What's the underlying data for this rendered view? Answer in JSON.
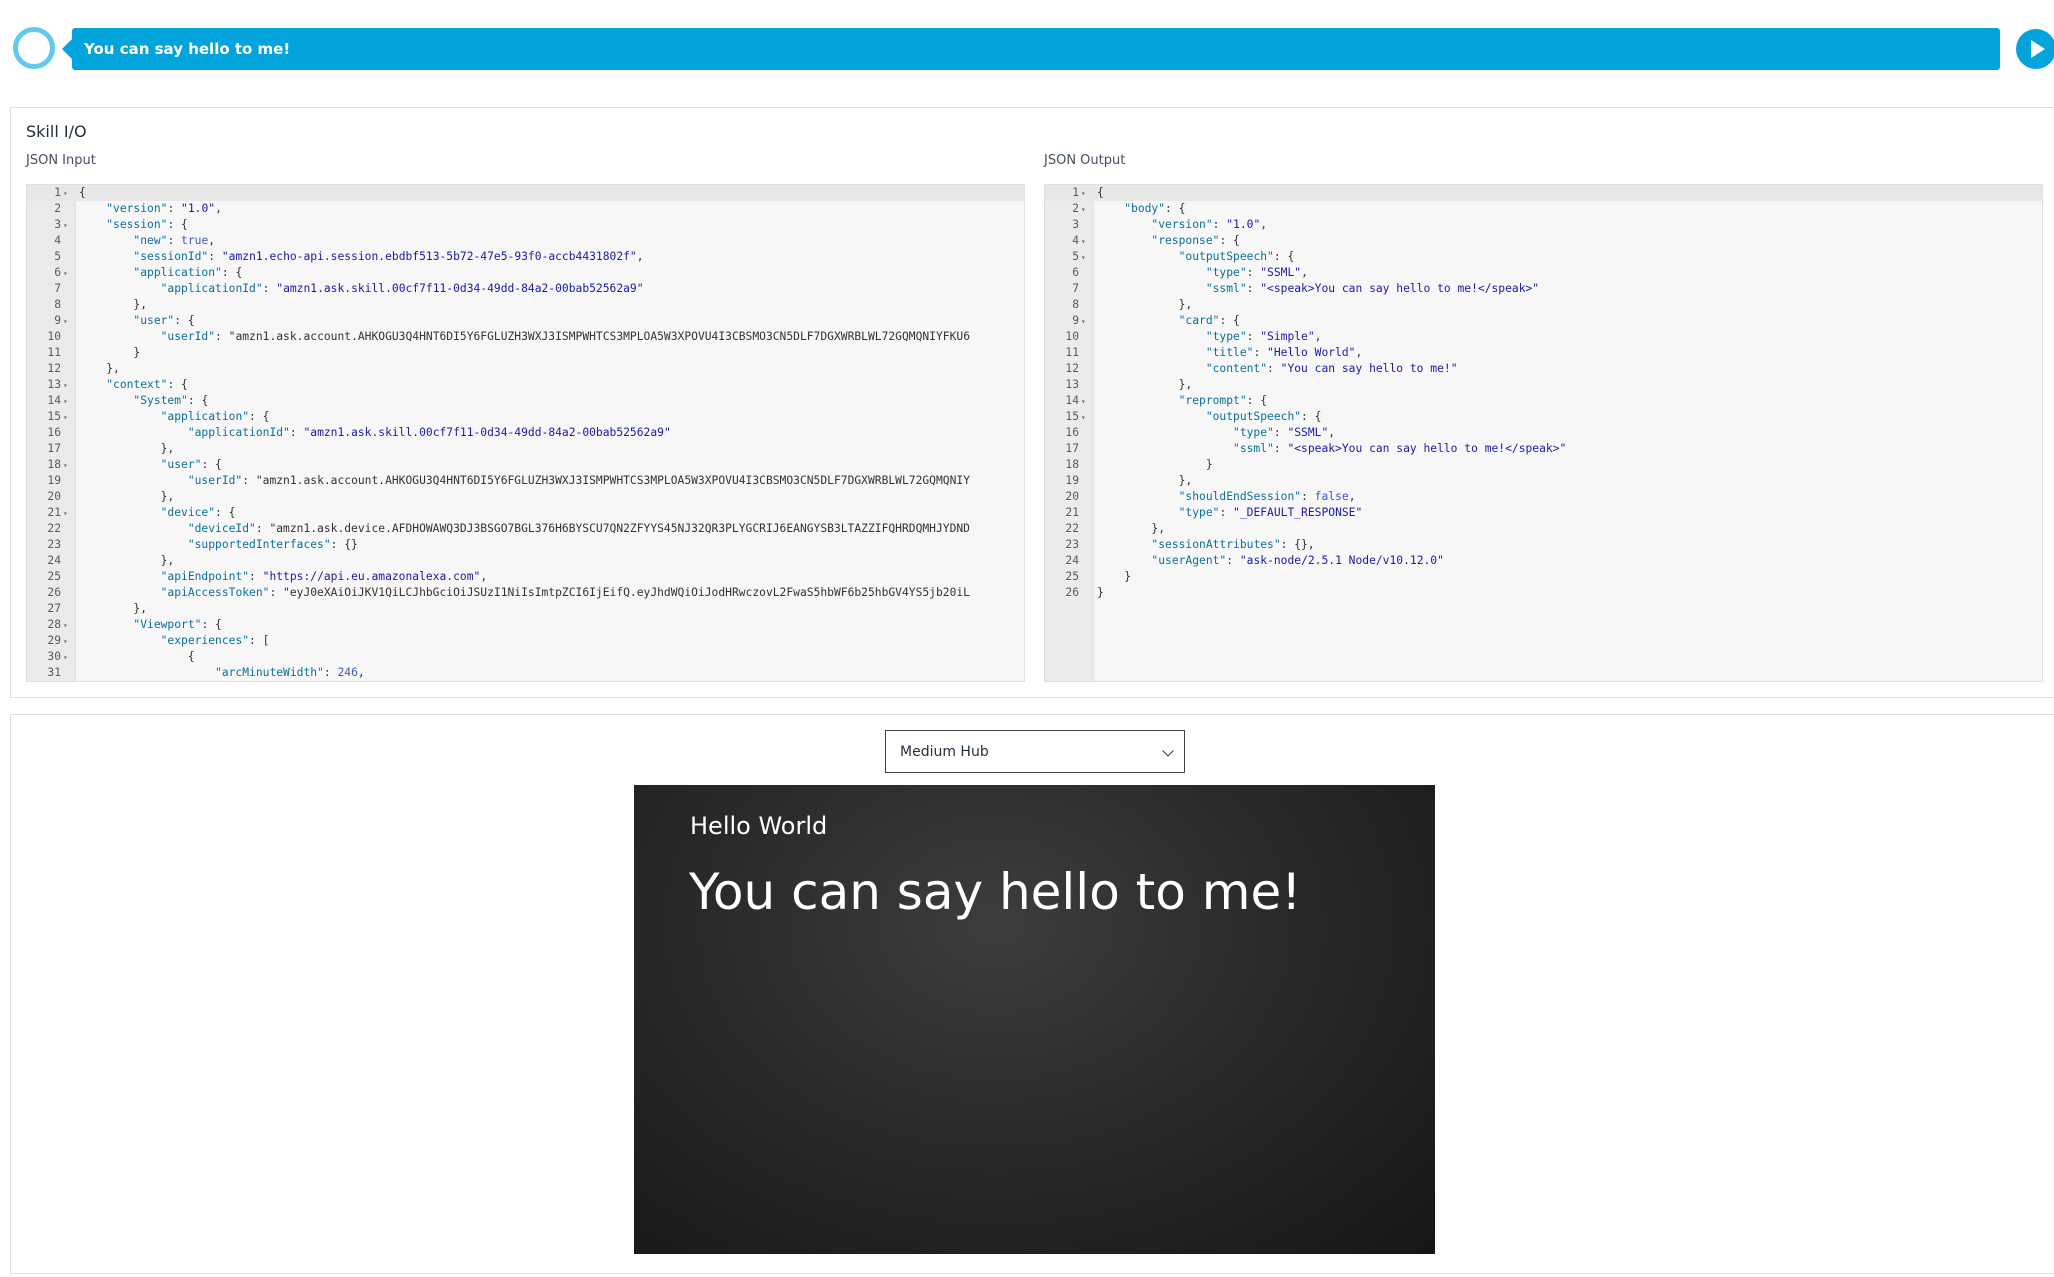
{
  "speech": {
    "text": "You can say hello to me!"
  },
  "skill_io": {
    "title": "Skill I/O",
    "input_label": "JSON Input",
    "output_label": "JSON Output"
  },
  "json_input_lines": [
    {
      "n": "1",
      "f": "▾",
      "t": "{"
    },
    {
      "n": "2",
      "f": "",
      "t": "    \"version\": \"1.0\","
    },
    {
      "n": "3",
      "f": "▾",
      "t": "    \"session\": {"
    },
    {
      "n": "4",
      "f": "",
      "t": "        \"new\": true,"
    },
    {
      "n": "5",
      "f": "",
      "t": "        \"sessionId\": \"amzn1.echo-api.session.ebdbf513-5b72-47e5-93f0-accb4431802f\","
    },
    {
      "n": "6",
      "f": "▾",
      "t": "        \"application\": {"
    },
    {
      "n": "7",
      "f": "",
      "t": "            \"applicationId\": \"amzn1.ask.skill.00cf7f11-0d34-49dd-84a2-00bab52562a9\""
    },
    {
      "n": "8",
      "f": "",
      "t": "        },"
    },
    {
      "n": "9",
      "f": "▾",
      "t": "        \"user\": {"
    },
    {
      "n": "10",
      "f": "",
      "t": "            \"userId\": \"amzn1.ask.account.AHKOGU3Q4HNT6DI5Y6FGLUZH3WXJ3ISMPWHTCS3MPLOA5W3XPOVU4I3CBSMO3CN5DLF7DGXWRBLWL72GQMQNIYFKU6"
    },
    {
      "n": "11",
      "f": "",
      "t": "        }"
    },
    {
      "n": "12",
      "f": "",
      "t": "    },"
    },
    {
      "n": "13",
      "f": "▾",
      "t": "    \"context\": {"
    },
    {
      "n": "14",
      "f": "▾",
      "t": "        \"System\": {"
    },
    {
      "n": "15",
      "f": "▾",
      "t": "            \"application\": {"
    },
    {
      "n": "16",
      "f": "",
      "t": "                \"applicationId\": \"amzn1.ask.skill.00cf7f11-0d34-49dd-84a2-00bab52562a9\""
    },
    {
      "n": "17",
      "f": "",
      "t": "            },"
    },
    {
      "n": "18",
      "f": "▾",
      "t": "            \"user\": {"
    },
    {
      "n": "19",
      "f": "",
      "t": "                \"userId\": \"amzn1.ask.account.AHKOGU3Q4HNT6DI5Y6FGLUZH3WXJ3ISMPWHTCS3MPLOA5W3XPOVU4I3CBSMO3CN5DLF7DGXWRBLWL72GQMQNIY"
    },
    {
      "n": "20",
      "f": "",
      "t": "            },"
    },
    {
      "n": "21",
      "f": "▾",
      "t": "            \"device\": {"
    },
    {
      "n": "22",
      "f": "",
      "t": "                \"deviceId\": \"amzn1.ask.device.AFDHOWAWQ3DJ3BSGO7BGL376H6BYSCU7QN2ZFYYS45NJ32QR3PLYGCRIJ6EANGYSB3LTAZZIFQHRDQMHJYDND"
    },
    {
      "n": "23",
      "f": "",
      "t": "                \"supportedInterfaces\": {}"
    },
    {
      "n": "24",
      "f": "",
      "t": "            },"
    },
    {
      "n": "25",
      "f": "",
      "t": "            \"apiEndpoint\": \"https://api.eu.amazonalexa.com\","
    },
    {
      "n": "26",
      "f": "",
      "t": "            \"apiAccessToken\": \"eyJ0eXAiOiJKV1QiLCJhbGciOiJSUzI1NiIsImtpZCI6IjEifQ.eyJhdWQiOiJodHRwczovL2FwaS5hbWF6b25hbGV4YS5jb20iL"
    },
    {
      "n": "27",
      "f": "",
      "t": "        },"
    },
    {
      "n": "28",
      "f": "▾",
      "t": "        \"Viewport\": {"
    },
    {
      "n": "29",
      "f": "▾",
      "t": "            \"experiences\": ["
    },
    {
      "n": "30",
      "f": "▾",
      "t": "                {"
    },
    {
      "n": "31",
      "f": "",
      "t": "                    \"arcMinuteWidth\": 246,"
    }
  ],
  "json_output_lines": [
    {
      "n": "1",
      "f": "▾",
      "t": "{"
    },
    {
      "n": "2",
      "f": "▾",
      "t": "    \"body\": {"
    },
    {
      "n": "3",
      "f": "",
      "t": "        \"version\": \"1.0\","
    },
    {
      "n": "4",
      "f": "▾",
      "t": "        \"response\": {"
    },
    {
      "n": "5",
      "f": "▾",
      "t": "            \"outputSpeech\": {"
    },
    {
      "n": "6",
      "f": "",
      "t": "                \"type\": \"SSML\","
    },
    {
      "n": "7",
      "f": "",
      "t": "                \"ssml\": \"<speak>You can say hello to me!</speak>\""
    },
    {
      "n": "8",
      "f": "",
      "t": "            },"
    },
    {
      "n": "9",
      "f": "▾",
      "t": "            \"card\": {"
    },
    {
      "n": "10",
      "f": "",
      "t": "                \"type\": \"Simple\","
    },
    {
      "n": "11",
      "f": "",
      "t": "                \"title\": \"Hello World\","
    },
    {
      "n": "12",
      "f": "",
      "t": "                \"content\": \"You can say hello to me!\""
    },
    {
      "n": "13",
      "f": "",
      "t": "            },"
    },
    {
      "n": "14",
      "f": "▾",
      "t": "            \"reprompt\": {"
    },
    {
      "n": "15",
      "f": "▾",
      "t": "                \"outputSpeech\": {"
    },
    {
      "n": "16",
      "f": "",
      "t": "                    \"type\": \"SSML\","
    },
    {
      "n": "17",
      "f": "",
      "t": "                    \"ssml\": \"<speak>You can say hello to me!</speak>\""
    },
    {
      "n": "18",
      "f": "",
      "t": "                }"
    },
    {
      "n": "19",
      "f": "",
      "t": "            },"
    },
    {
      "n": "20",
      "f": "",
      "t": "            \"shouldEndSession\": false,"
    },
    {
      "n": "21",
      "f": "",
      "t": "            \"type\": \"_DEFAULT_RESPONSE\""
    },
    {
      "n": "22",
      "f": "",
      "t": "        },"
    },
    {
      "n": "23",
      "f": "",
      "t": "        \"sessionAttributes\": {},"
    },
    {
      "n": "24",
      "f": "",
      "t": "        \"userAgent\": \"ask-node/2.5.1 Node/v10.12.0\""
    },
    {
      "n": "25",
      "f": "",
      "t": "    }"
    },
    {
      "n": "26",
      "f": "",
      "t": "}"
    }
  ],
  "preview": {
    "device_select_value": "Medium Hub",
    "card_title": "Hello World",
    "card_content": "You can say hello to me!"
  },
  "colors": {
    "accent": "#03a4dc",
    "ring": "#63c8ed"
  },
  "icons": [
    "alexa-ring-icon",
    "play-icon",
    "chevron-down-icon",
    "fold-arrow-icon"
  ]
}
